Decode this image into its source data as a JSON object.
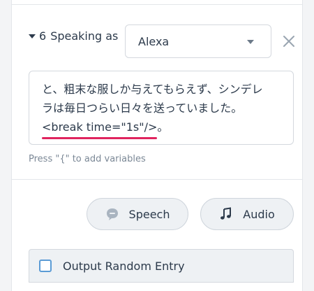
{
  "step": {
    "number": "6",
    "label": "Speaking as"
  },
  "voice_select": {
    "value": "Alexa"
  },
  "speech_text": {
    "line1": "と、粗末な服しか与えてもらえず、シンデレ",
    "line2": "ラは毎日つらい日々を送っていました。",
    "line3_ssml": "<break time=\"1s\"/>",
    "line3_tail": "。"
  },
  "hint": "Press \"{\" to add variables",
  "buttons": {
    "speech_label": "Speech",
    "audio_label": "Audio"
  },
  "random_entry": {
    "label": "Output Random Entry",
    "checked": false
  },
  "colors": {
    "accent": "#5b9bd5",
    "error_underline": "#e0245e",
    "text": "#2c3a4b",
    "muted": "#7b8896"
  },
  "icons": [
    "chevron-down-icon",
    "close-icon",
    "speech-bubble-icon",
    "music-note-icon"
  ]
}
